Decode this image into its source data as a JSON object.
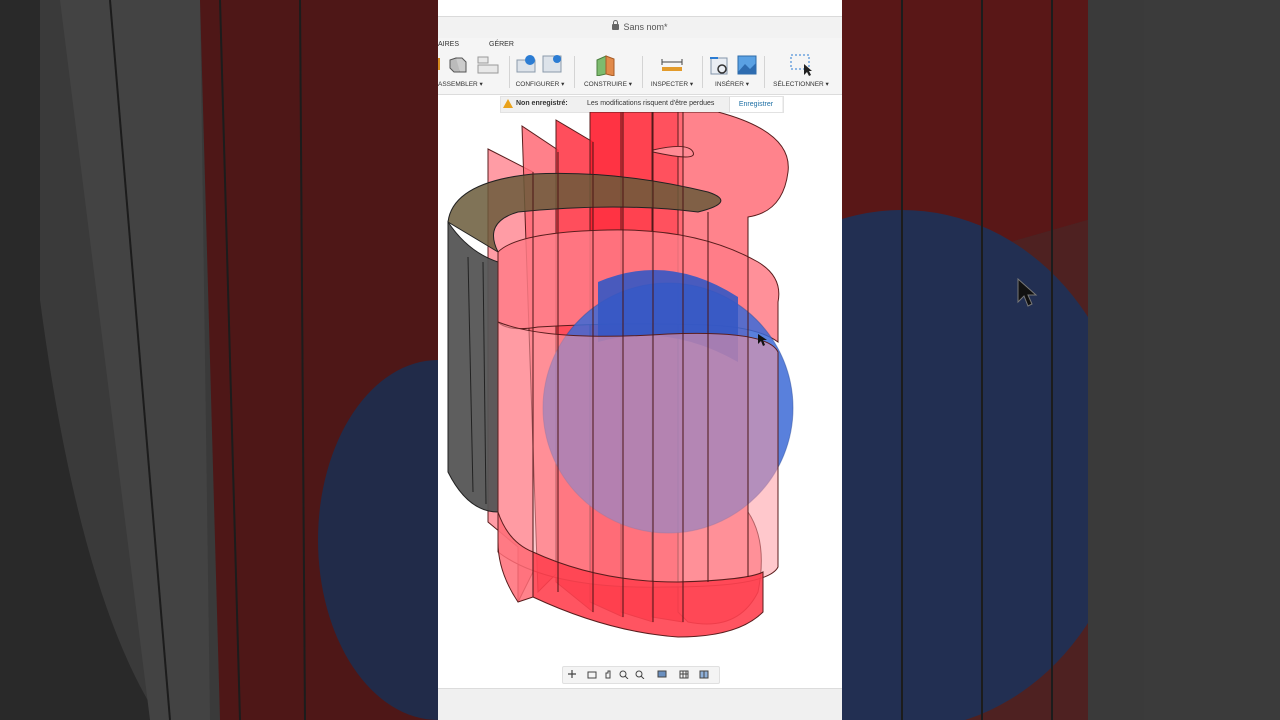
{
  "window": {
    "title": "Sans nom*"
  },
  "ribbon": {
    "tabs": [
      {
        "label": "AIRES"
      },
      {
        "label": "GÉRER"
      }
    ],
    "groups": [
      {
        "label": "ASSEMBLER ▾",
        "icon": "assemble-icon"
      },
      {
        "label": "CONFIGURER ▾",
        "icon": "configure-icon"
      },
      {
        "label": "CONSTRUIRE ▾",
        "icon": "construct-plane-icon"
      },
      {
        "label": "INSPECTER ▾",
        "icon": "measure-icon"
      },
      {
        "label": "INSÉRER ▾",
        "icon": "insert-icon"
      },
      {
        "label": "SÉLECTIONNER ▾",
        "icon": "select-icon"
      }
    ]
  },
  "notice": {
    "title": "Non enregistré:",
    "message": "Les modifications risquent d'être perdues",
    "button": "Enregistrer"
  },
  "colors": {
    "surface_red": "#ff3b4a",
    "sphere_blue": "#3c6ad6",
    "accent": "#1c6ea4"
  },
  "navbar": {
    "icons": [
      "orbit-icon",
      "look-at-icon",
      "pan-icon",
      "zoom-window-icon",
      "zoom-icon",
      "display-settings-icon",
      "grid-icon",
      "viewports-icon"
    ]
  }
}
